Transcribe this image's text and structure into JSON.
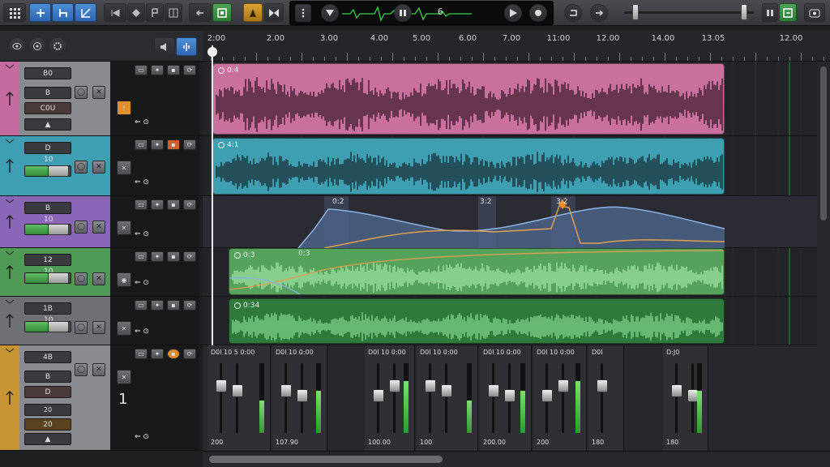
{
  "toolbar": {
    "display_value": "6",
    "buttons": [
      "grid-icon",
      "add-icon",
      "skip-back-icon",
      "automation-icon",
      "rewind-icon",
      "stop-icon",
      "record-icon",
      "play-icon",
      "loop-icon",
      "undo-icon",
      "redo-icon",
      "pause-icon",
      "export-icon",
      "settings-icon"
    ]
  },
  "ruler": {
    "labels": [
      "2:00",
      "2.00",
      "3.00",
      "4.00",
      "5.00",
      "6.00",
      "7.00",
      "11:00",
      "12.00",
      "14.00",
      "13.05",
      "12.00"
    ]
  },
  "tracks": [
    {
      "color": "#c56b9f",
      "panel": "#8a8b8e",
      "name": "B0",
      "field2": "B",
      "field3": "C0U",
      "clip_label": "0:4"
    },
    {
      "color": "#3d9fb1",
      "panel": "#3d9fb1",
      "name": "D",
      "field2": "10",
      "clip_label": "4:1"
    },
    {
      "color": "#8a66b8",
      "panel": "#8a66b8",
      "name": "B",
      "field2": "10"
    },
    {
      "color": "#4f9a55",
      "panel": "#4f9a55",
      "name": "12",
      "field2": "10",
      "clip_label": "0:3"
    },
    {
      "color": "#6e7073",
      "panel": "#6e7073",
      "name": "1B",
      "field2": "10",
      "clip_label": "0:34"
    },
    {
      "color": "#c89433",
      "panel": "#8a8b8e",
      "name": "4B",
      "field2": "B",
      "field3": "D",
      "field4": "20",
      "field5": "20",
      "counter": "1"
    }
  ],
  "automation": {
    "markers": [
      "0:2",
      "3:2",
      "3:2"
    ],
    "label": "0:3"
  },
  "mixer": {
    "strips": [
      {
        "label": "D0l 10 5 0:00",
        "value": "200"
      },
      {
        "label": "D0l 10 0:00",
        "value": "107.90"
      },
      {
        "label": "D0l 10 0:00",
        "value": "100.00"
      },
      {
        "label": "D0l 10 0:00",
        "value": "100"
      },
      {
        "label": "D0l 10 0:00",
        "value": "200.00"
      },
      {
        "label": "D0l 10 0:00",
        "value": "200"
      },
      {
        "label": "D0l",
        "value": "180"
      },
      {
        "label": "D:J0",
        "value": "180"
      }
    ]
  },
  "colors": {
    "accent": "#3d7fd6",
    "track_pink": "#c56b9f",
    "track_teal": "#3d9fb1",
    "track_purple": "#8a66b8",
    "track_green": "#4f9a55"
  }
}
